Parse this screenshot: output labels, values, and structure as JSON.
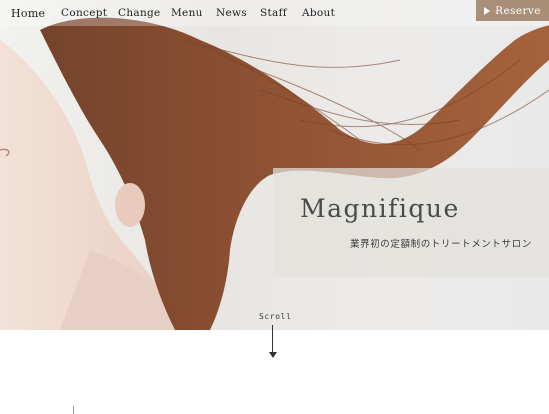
{
  "nav": {
    "items": [
      {
        "label": "Home"
      },
      {
        "label": "Concept"
      },
      {
        "label": "Change"
      },
      {
        "label": "Menu"
      },
      {
        "label": "News"
      },
      {
        "label": "Staff"
      },
      {
        "label": "About"
      }
    ],
    "reserve_label": "Reserve"
  },
  "hero": {
    "brand": "Magnifique",
    "tagline": "業界初の定額制のトリートメントサロン",
    "scroll_label": "Scroll"
  },
  "colors": {
    "accent": "#a98f78",
    "hair": "#8a4a2a",
    "skin": "#efd9cd"
  },
  "icons": {
    "reserve": "play-triangle-icon",
    "scroll": "arrow-down-icon"
  }
}
